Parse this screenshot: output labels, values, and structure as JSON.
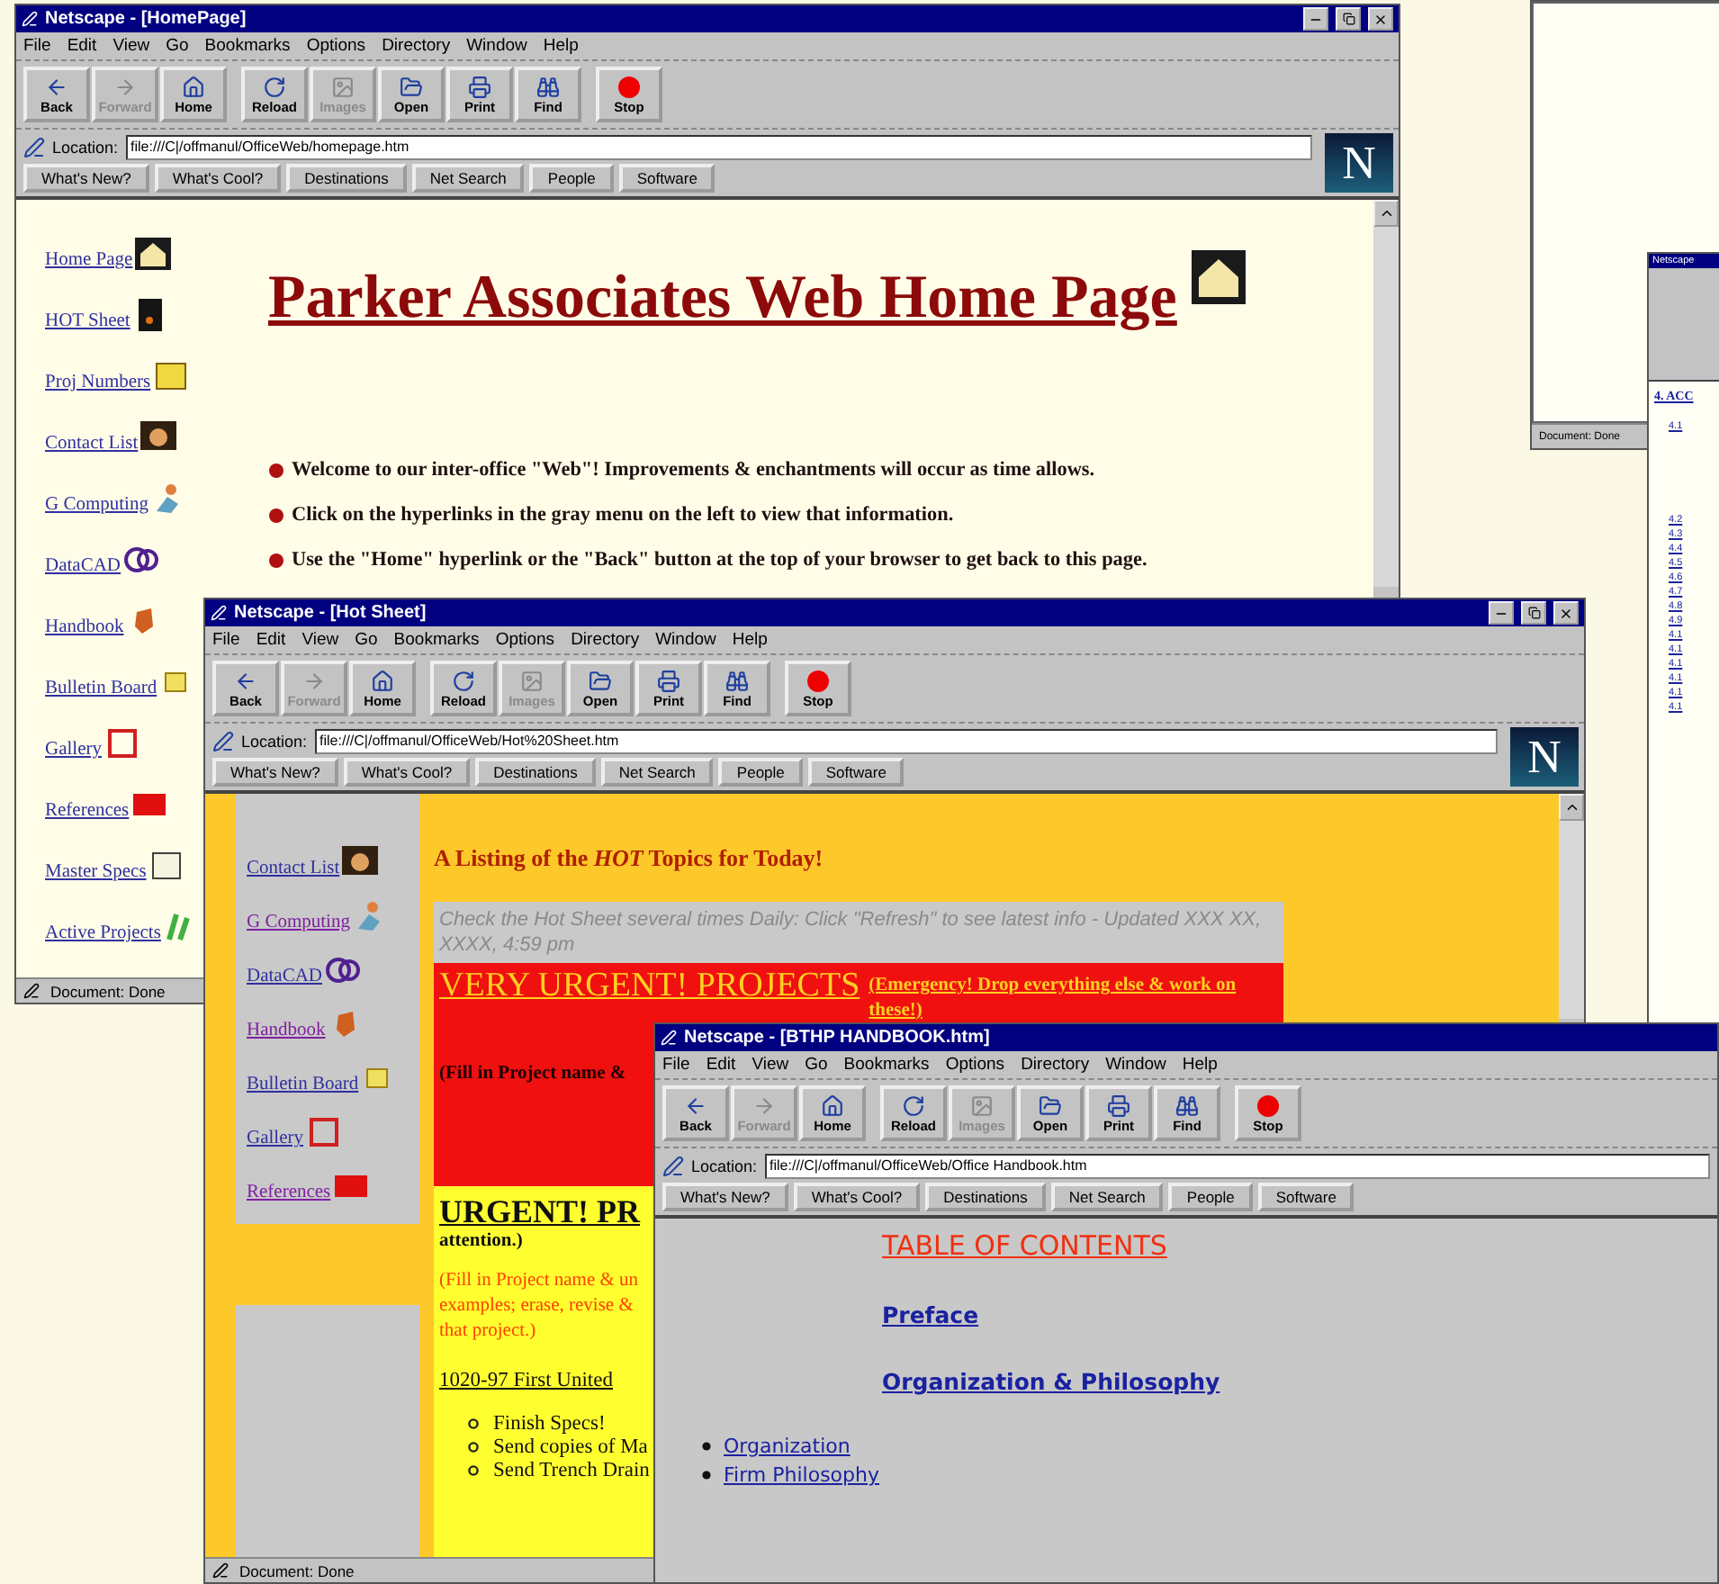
{
  "windows": [
    {
      "kind": "home",
      "title": "Netscape - [HomePage]",
      "menu": [
        "File",
        "Edit",
        "View",
        "Go",
        "Bookmarks",
        "Options",
        "Directory",
        "Window",
        "Help"
      ],
      "toolbar": [
        {
          "label": "Back",
          "disabled": false
        },
        {
          "label": "Forward",
          "disabled": true
        },
        {
          "label": "Home",
          "disabled": false
        },
        {
          "label": "Reload",
          "disabled": false
        },
        {
          "label": "Images",
          "disabled": true
        },
        {
          "label": "Open",
          "disabled": false
        },
        {
          "label": "Print",
          "disabled": false
        },
        {
          "label": "Find",
          "disabled": false
        },
        {
          "label": "Stop",
          "disabled": false
        }
      ],
      "location": {
        "label": "Location:",
        "value": "file:///C|/offmanul/OfficeWeb/homepage.htm"
      },
      "directory": [
        "What's New?",
        "What's Cool?",
        "Destinations",
        "Net Search",
        "People",
        "Software"
      ],
      "logo": "N",
      "sidebar": [
        "Home Page",
        "HOT Sheet",
        "Proj Numbers",
        "Contact List",
        "G Computing",
        "DataCAD",
        "Handbook",
        "Bulletin Board",
        "Gallery",
        "References",
        "Master Specs",
        "Active Projects"
      ],
      "heading": "Parker Associates Web Home Page",
      "bullets": [
        "Welcome to our inter-office \"Web\"! Improvements & enchantments will occur as time allows.",
        "Click on the hyperlinks in the gray menu on the left to view that information.",
        "Use the \"Home\" hyperlink or the \"Back\" button at the top of your browser to get back to this page."
      ],
      "status": "Document: Done"
    },
    {
      "kind": "hot",
      "title": "Netscape - [Hot Sheet]",
      "menu": [
        "File",
        "Edit",
        "View",
        "Go",
        "Bookmarks",
        "Options",
        "Directory",
        "Window",
        "Help"
      ],
      "toolbar": [
        {
          "label": "Back",
          "disabled": false
        },
        {
          "label": "Forward",
          "disabled": true
        },
        {
          "label": "Home",
          "disabled": false
        },
        {
          "label": "Reload",
          "disabled": false
        },
        {
          "label": "Images",
          "disabled": true
        },
        {
          "label": "Open",
          "disabled": false
        },
        {
          "label": "Print",
          "disabled": false
        },
        {
          "label": "Find",
          "disabled": false
        },
        {
          "label": "Stop",
          "disabled": false
        }
      ],
      "location": {
        "label": "Location:",
        "value": "file:///C|/offmanul/OfficeWeb/Hot%20Sheet.htm"
      },
      "directory": [
        "What's New?",
        "What's Cool?",
        "Destinations",
        "Net Search",
        "People",
        "Software"
      ],
      "logo": "N",
      "sidebar": [
        "Contact List",
        "G Computing",
        "DataCAD",
        "Handbook",
        "Bulletin Board",
        "Gallery",
        "References"
      ],
      "intro": "A Listing of the *HOT* Topics for Today!",
      "notice": "Check the Hot Sheet several times Daily: Click \"Refresh\" to see latest info - Updated XXX XX, XXXX, 4:59 pm",
      "very_urgent": {
        "heading": "VERY URGENT! PROJECTS",
        "note": "(Emergency! Drop everything else & work on these!)",
        "fill": "(Fill in Project name &"
      },
      "urgent": {
        "heading": "URGENT! PR",
        "note": "attention.)",
        "fill": [
          "(Fill in Project name & un",
          "examples; erase, revise &",
          "that project.)"
        ],
        "project": "1020-97 First United",
        "tasks": [
          "Finish Specs!",
          "Send copies of Ma",
          "Send Trench Drain"
        ]
      },
      "status": "Document: Done"
    },
    {
      "kind": "handbook",
      "title": "Netscape - [BTHP HANDBOOK.htm]",
      "menu": [
        "File",
        "Edit",
        "View",
        "Go",
        "Bookmarks",
        "Options",
        "Directory",
        "Window",
        "Help"
      ],
      "toolbar": [
        {
          "label": "Back",
          "disabled": false
        },
        {
          "label": "Forward",
          "disabled": true
        },
        {
          "label": "Home",
          "disabled": false
        },
        {
          "label": "Reload",
          "disabled": false
        },
        {
          "label": "Images",
          "disabled": true
        },
        {
          "label": "Open",
          "disabled": false
        },
        {
          "label": "Print",
          "disabled": false
        },
        {
          "label": "Find",
          "disabled": false
        },
        {
          "label": "Stop",
          "disabled": false
        }
      ],
      "location": {
        "label": "Location:",
        "value": "file:///C|/offmanul/OfficeWeb/Office Handbook.htm"
      },
      "directory": [
        "What's New?",
        "What's Cool?",
        "Destinations",
        "Net Search",
        "People",
        "Software"
      ],
      "toc_title": "TABLE OF CONTENTS",
      "sections": [
        "Preface",
        "Organization & Philosophy"
      ],
      "links": [
        "Organization",
        "Firm Philosophy"
      ]
    },
    {
      "kind": "blank",
      "status": "Document: Done"
    },
    {
      "kind": "mini",
      "title": "Netscape",
      "heading": "4. ACC",
      "items": [
        "4.1",
        "4.2",
        "4.3",
        "4.4",
        "4.5",
        "4.6",
        "4.7",
        "4.8",
        "4.9",
        "4.1",
        "4.1",
        "4.1",
        "4.1",
        "4.1",
        "4.1"
      ]
    }
  ]
}
